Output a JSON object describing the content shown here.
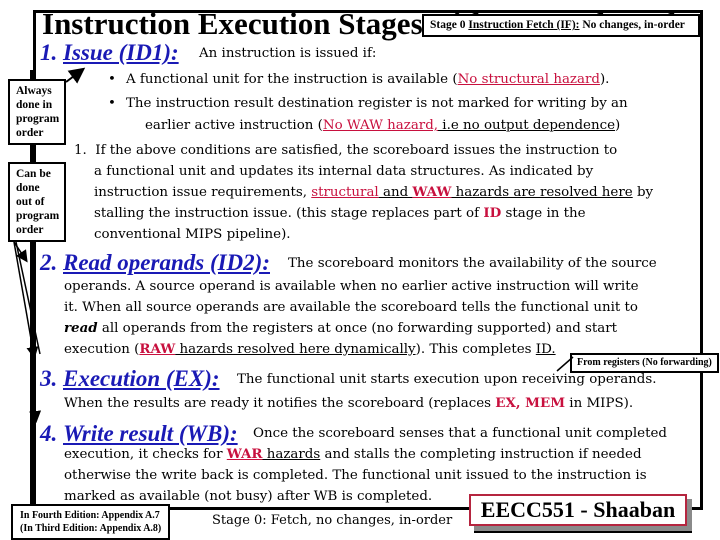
{
  "title": "Instruction Execution Stages with A Scoreboard",
  "stage0_box": {
    "prefix": "Stage 0 ",
    "link": "Instruction Fetch (IF):",
    "suffix": " No changes, in-order"
  },
  "side_notes": {
    "always": [
      "Always",
      "done in",
      "program",
      "order"
    ],
    "out_of_order": [
      "Can be",
      "done",
      "out of",
      "program",
      "order"
    ]
  },
  "sections": {
    "issue": {
      "heading": "1.  Issue (ID1):",
      "num": "1.",
      "label": "Issue (ID1):",
      "intro": "An instruction is issued if:",
      "bullet1_pre": "A functional unit for the instruction is available (",
      "bullet1_hazard": "No structural hazard",
      "bullet1_post": ").",
      "bullet2_line1": "The instruction result destination register is not marked for writing by an",
      "bullet2_line2_pre": "earlier active instruction (",
      "bullet2_hazard": "No WAW hazard,",
      "bullet2_ul": " i.e no output dependence",
      "bullet2_post": ")",
      "num_item": "1.",
      "para_line1": "If the above conditions are satisfied, the scoreboard issues the instruction to",
      "para_line2": "a functional unit and updates its internal data structures.  As indicated by",
      "para_line3_pre": "instruction issue requirements, ",
      "para_line3_structural": "structural",
      "para_line3_and": " and ",
      "para_line3_waw": "WAW",
      "para_line3_ul": " hazards are resolved here",
      "para_line3_post": " by",
      "para_line4_pre": "stalling the instruction issue.  (this stage replaces part of ",
      "para_line4_id": "ID",
      "para_line4_post": " stage in the",
      "para_line5": "conventional MIPS pipeline)."
    },
    "read": {
      "num": "2.",
      "label": "Read operands (ID2):",
      "intro": "The scoreboard monitors the availability of the source",
      "line2": "operands.  A source operand is available  when no earlier active instruction will write",
      "line3": "it. When all source operands are available the scoreboard tells the functional unit to",
      "line4_italic": "read",
      "line4_rest": "  all operands from the registers at once (no forwarding supported) and start",
      "line5_pre": "execution  (",
      "line5_raw": "RAW",
      "line5_ul": " hazards resolved here dynamically",
      "line5_post": ").  This completes ",
      "line5_id": "ID."
    },
    "execution": {
      "num": "3.",
      "label": "Execution (EX):",
      "intro": "The functional unit starts execution upon receiving operands.",
      "line2_pre": "When the results are ready it notifies the scoreboard (replaces ",
      "line2_ex": "EX,  MEM",
      "line2_post": " in MIPS)."
    },
    "write": {
      "num": "4.",
      "label": "Write result (WB):",
      "intro": "Once the scoreboard senses that a functional unit completed",
      "line2_pre": "execution, it checks for ",
      "line2_war": "WAR",
      "line2_ul": " hazards",
      "line2_post": " and stalls the completing instruction if needed",
      "line3": "otherwise the write back is completed.  The functional unit issued to the instruction is",
      "line4": "marked as available (not busy) after WB is completed."
    }
  },
  "callouts": {
    "from_registers": "From registers (No forwarding)"
  },
  "footer": {
    "edition_line1": "In Fourth Edition: Appendix A.7",
    "edition_line2": "(In Third Edition: Appendix A.8)",
    "stage0_note": "Stage 0:  Fetch, no changes, in-order",
    "course": "EECC551 - Shaaban"
  },
  "colors": {
    "heading_blue": "#1a1ab5",
    "hazard_red": "#c8103e",
    "footer_border": "#b5253f"
  }
}
